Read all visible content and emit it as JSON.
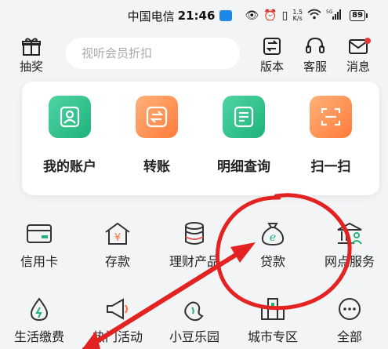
{
  "status_bar": {
    "carrier": "中国电信",
    "time": "21:46",
    "net_speed_value": "1.5",
    "net_speed_unit": "K/s",
    "signal_label": "5G",
    "battery": "89"
  },
  "header": {
    "lottery_label": "抽奖",
    "search_placeholder": "视听会员折扣",
    "version_label": "版本",
    "service_label": "客服",
    "messages_label": "消息"
  },
  "quick_actions": [
    {
      "label": "我的账户",
      "icon": "person-card-icon",
      "color": "#22b27a"
    },
    {
      "label": "转账",
      "icon": "transfer-arrows-icon",
      "color": "#ff8a45"
    },
    {
      "label": "明细查询",
      "icon": "document-lines-icon",
      "color": "#22b27a"
    },
    {
      "label": "扫一扫",
      "icon": "scan-frame-icon",
      "color": "#ff8a45"
    }
  ],
  "services_row1": [
    {
      "label": "信用卡",
      "icon": "credit-card-icon"
    },
    {
      "label": "存款",
      "icon": "house-yen-icon"
    },
    {
      "label": "理财产品",
      "icon": "coin-stack-icon"
    },
    {
      "label": "贷款",
      "icon": "money-bag-icon"
    },
    {
      "label": "网点服务",
      "icon": "bank-branch-icon"
    }
  ],
  "services_row2": [
    {
      "label": "生活缴费",
      "icon": "water-drop-icon"
    },
    {
      "label": "热门活动",
      "icon": "megaphone-icon"
    },
    {
      "label": "小豆乐园",
      "icon": "bean-icon"
    },
    {
      "label": "城市专区",
      "icon": "city-building-icon"
    },
    {
      "label": "全部",
      "icon": "more-dots-icon"
    }
  ],
  "colors": {
    "accent_green": "#22b27a",
    "accent_orange": "#ff8a45",
    "annotation_red": "#e32222"
  }
}
